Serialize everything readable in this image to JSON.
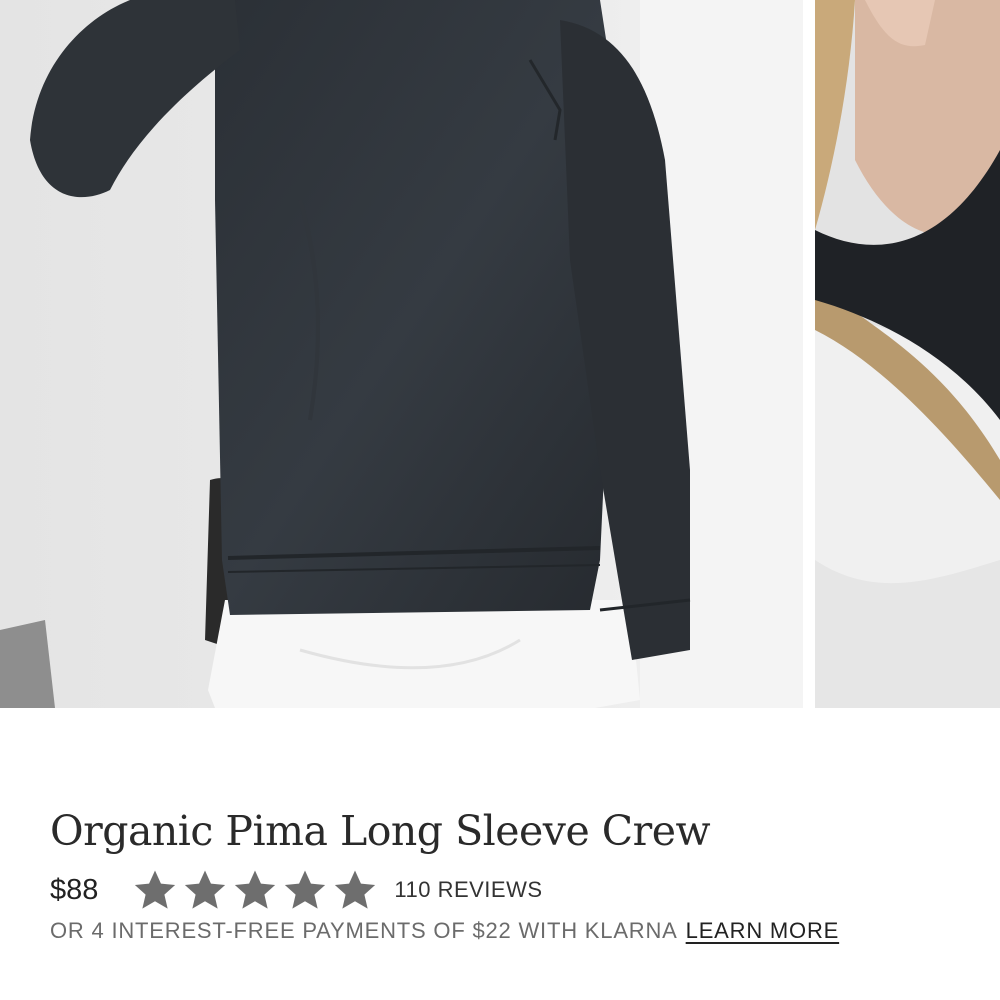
{
  "product": {
    "title": "Organic Pima Long Sleeve Crew",
    "price": "$88",
    "rating": {
      "stars_filled": 5,
      "stars_total": 5,
      "color": "#6e6e6e"
    },
    "reviews_label": "110 REVIEWS"
  },
  "klarna": {
    "text": "OR 4 INTEREST-FREE PAYMENTS OF $22 WITH KLARNA",
    "link_label": "LEARN MORE"
  },
  "gallery": {
    "images": [
      {
        "name": "product-photo-front",
        "alt": ""
      },
      {
        "name": "product-photo-detail",
        "alt": ""
      }
    ]
  },
  "colors": {
    "garment": "#2a2e33",
    "text_dark": "#222222",
    "text_muted": "#6b6b6b"
  }
}
